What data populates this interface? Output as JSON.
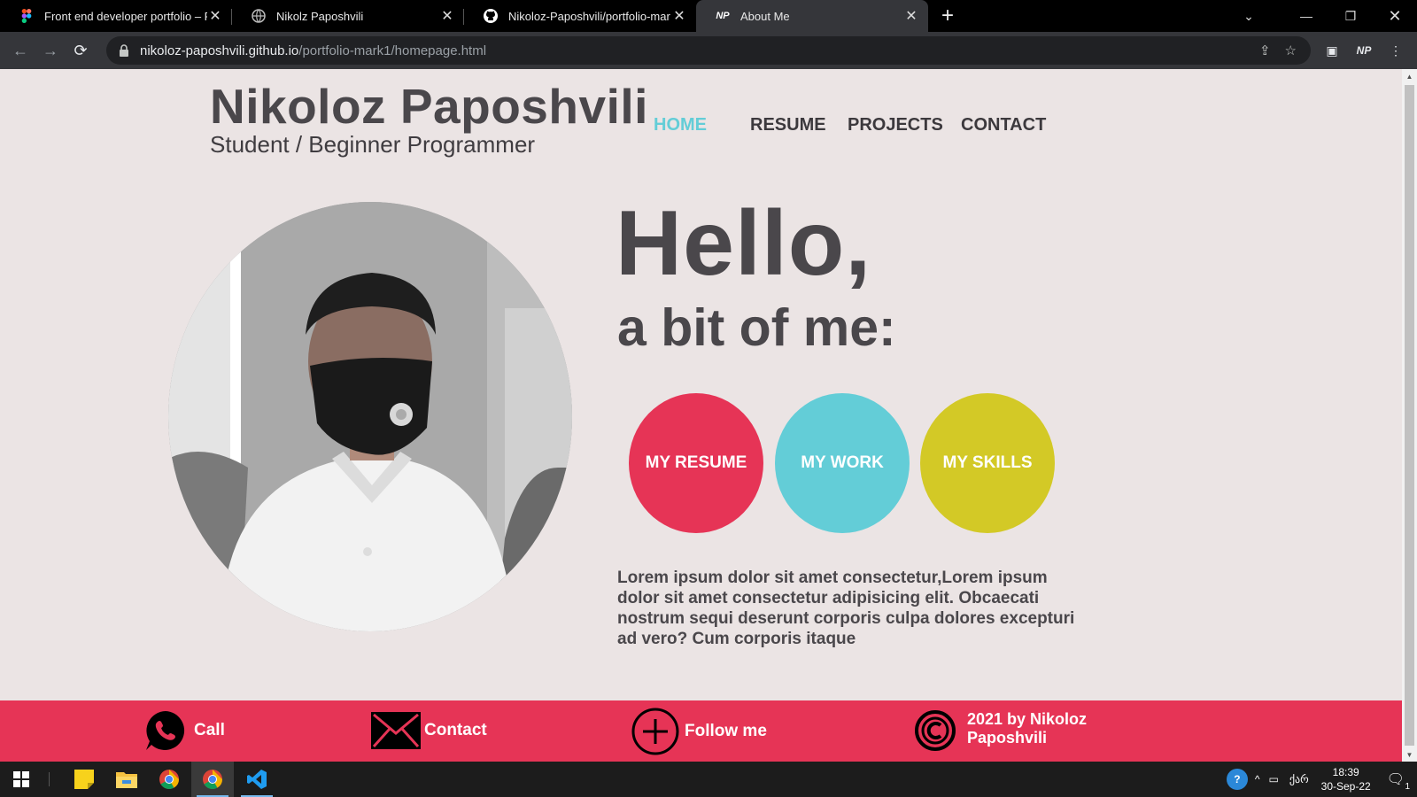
{
  "browser": {
    "tabs": [
      {
        "title": "Front end developer portfolio – F",
        "icon": "figma-icon",
        "active": false
      },
      {
        "title": "Nikolz Paposhvili",
        "icon": "globe-icon",
        "active": false
      },
      {
        "title": "Nikoloz-Paposhvili/portfolio-mar",
        "icon": "github-icon",
        "active": false
      },
      {
        "title": "About Me",
        "icon": "np-logo-icon",
        "active": true
      }
    ],
    "url_host": "nikoloz-paposhvili.github.io",
    "url_path": "/portfolio-mark1/homepage.html",
    "profile_initials": "NP"
  },
  "site": {
    "name": "Nikoloz Paposhvili",
    "subtitle": "Student / Beginner Programmer",
    "nav": [
      "HOME",
      "RESUME",
      "PROJECTS",
      "CONTACT"
    ],
    "nav_active": "HOME"
  },
  "hero": {
    "greeting": "Hello,",
    "subheading": "a bit of me:",
    "buttons": [
      {
        "label": "MY RESUME",
        "color": "#e63456"
      },
      {
        "label": "MY WORK",
        "color": "#63cdd7"
      },
      {
        "label": "MY SKILLS",
        "color": "#d3c926"
      }
    ],
    "body": "Lorem ipsum dolor sit amet consectetur,Lorem ipsum dolor sit amet consectetur adipisicing elit. Obcaecati nostrum sequi deserunt corporis culpa dolores excepturi ad vero? Cum corporis itaque"
  },
  "footer": {
    "call": "Call",
    "contact": "Contact",
    "follow": "Follow me",
    "copyright_line1": "2021 by Nikoloz",
    "copyright_line2": "Paposhvili"
  },
  "colors": {
    "accent_red": "#e63456",
    "accent_cyan": "#63cdd7",
    "accent_yellow": "#d3c926",
    "page_bg": "#ebe4e4",
    "text_dark": "#4a474b"
  },
  "taskbar": {
    "time": "18:39",
    "date": "30-Sep-22",
    "language": "ქარ",
    "notification_count": "1"
  }
}
